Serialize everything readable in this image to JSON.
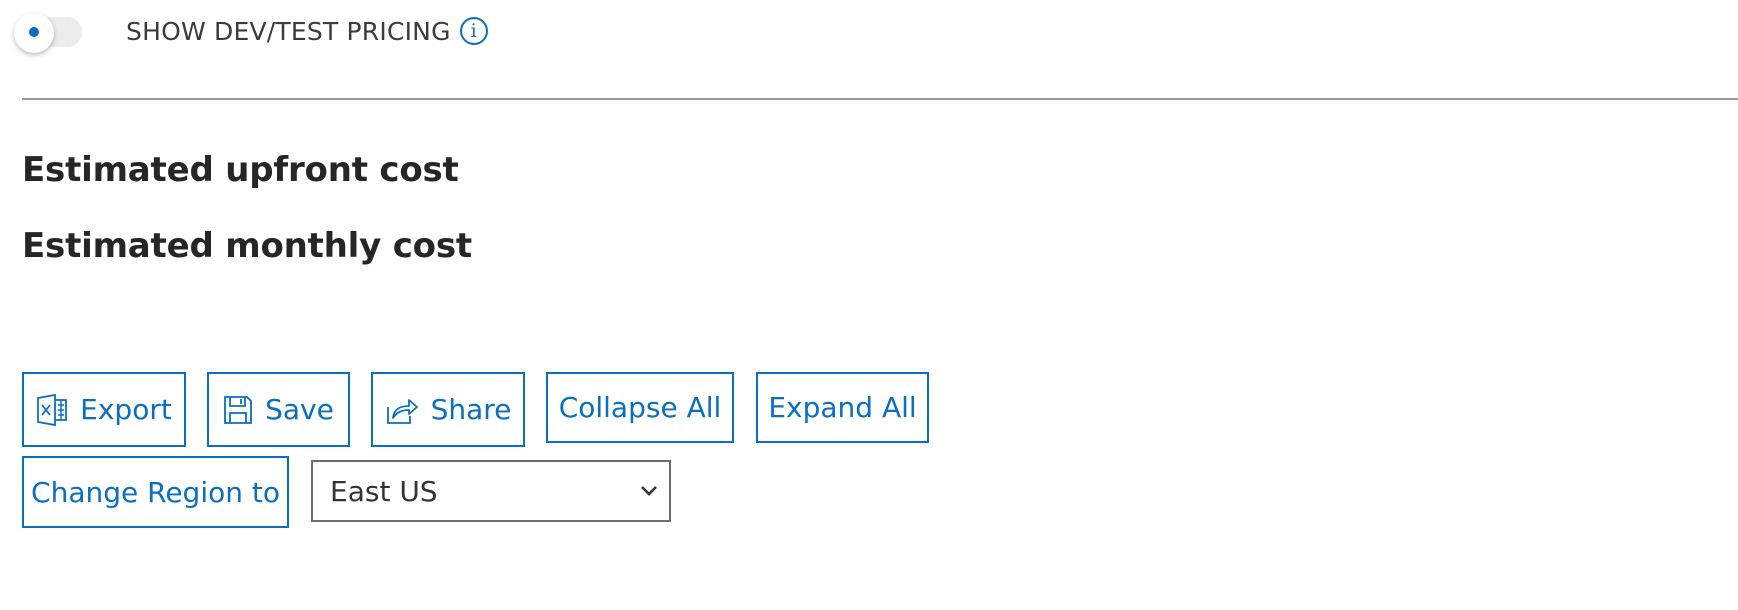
{
  "toggle": {
    "label": "SHOW DEV/TEST PRICING",
    "on": false,
    "info_glyph": "i"
  },
  "costs": {
    "upfront_label": "Estimated upfront cost",
    "monthly_label": "Estimated monthly cost"
  },
  "toolbar": {
    "export_label": "Export",
    "save_label": "Save",
    "share_label": "Share",
    "collapse_label": "Collapse All",
    "expand_label": "Expand All",
    "change_region_label": "Change Region to"
  },
  "region": {
    "selected": "East US"
  },
  "colors": {
    "accent": "#0a6fc2",
    "text": "#262626"
  },
  "icons": {
    "export": "excel-icon",
    "save": "floppy-disk-icon",
    "share": "share-arrow-icon",
    "select": "chevron-down-icon",
    "info": "info-icon"
  }
}
